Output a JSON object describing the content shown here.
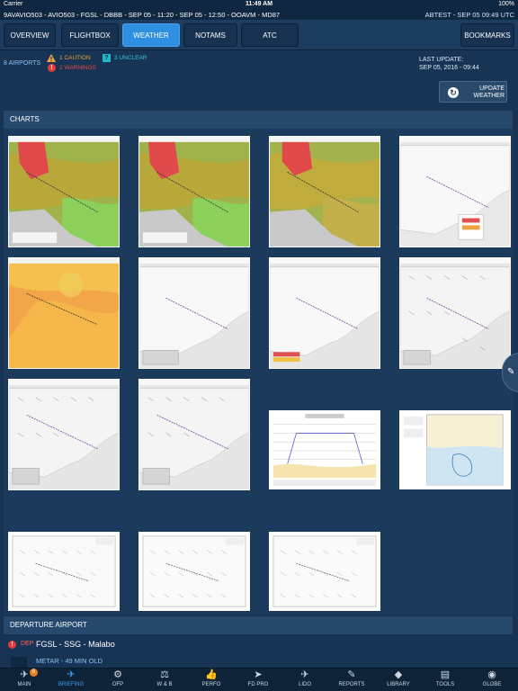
{
  "status": {
    "carrier": "Carrier",
    "time": "11:49 AM",
    "battery": "100%"
  },
  "flight": {
    "route": "9AVAVIO503 - AVIO503 - FGSL - DBBB - SEP 05 - 11:20 - SEP 05 - 12:50 - OOAVM - MD87",
    "user": "ABTEST - SEP 05 09:49 UTC"
  },
  "tabs": [
    "OVERVIEW",
    "FLIGHTBOX",
    "WEATHER",
    "NOTAMS",
    "ATC"
  ],
  "active_tab": "WEATHER",
  "bookmarks_label": "BOOKMARKS",
  "info": {
    "airports": "8 AIRPORTS",
    "caution": "1 CAUTION",
    "warnings": "2 WARNINGS",
    "unclear": "3 UNCLEAR",
    "last_update_label": "LAST UPDATE:",
    "last_update_value": "SEP 05, 2016 - 09:44"
  },
  "update_button": {
    "line1": "UPDATE",
    "line2": "WEATHER"
  },
  "sections": {
    "charts": "CHARTS",
    "departure": "DEPARTURE AIRPORT"
  },
  "departure": {
    "tag": "DEP",
    "name": "FGSL - SSG - Malabo",
    "metar": "METAR - 49 MIN OLD"
  },
  "colors": {
    "accent": "#2f8fe0",
    "caution": "#f2a33a",
    "warning": "#e23a3a",
    "unclear": "#22b6c9"
  },
  "tabbar": [
    {
      "label": "MAIN",
      "icon": "plane-icon",
      "glyph": "✈",
      "badge": "6"
    },
    {
      "label": "BRIEFING",
      "icon": "briefing-icon",
      "glyph": "✈",
      "active": true
    },
    {
      "label": "OFP",
      "icon": "ofp-icon",
      "glyph": "⚙"
    },
    {
      "label": "W & B",
      "icon": "balance-icon",
      "glyph": "⚖"
    },
    {
      "label": "PERFO",
      "icon": "thumbs-up-icon",
      "glyph": "👍"
    },
    {
      "label": "FD PRO",
      "icon": "navigation-icon",
      "glyph": "➤"
    },
    {
      "label": "LIDO",
      "icon": "lido-icon",
      "glyph": "✈"
    },
    {
      "label": "REPORTS",
      "icon": "reports-icon",
      "glyph": "✎"
    },
    {
      "label": "LIBRARY",
      "icon": "book-icon",
      "glyph": "◆"
    },
    {
      "label": "TOOLS",
      "icon": "toolbox-icon",
      "glyph": "▤"
    },
    {
      "label": "GLOBE",
      "icon": "globe-icon",
      "glyph": "◉"
    }
  ]
}
